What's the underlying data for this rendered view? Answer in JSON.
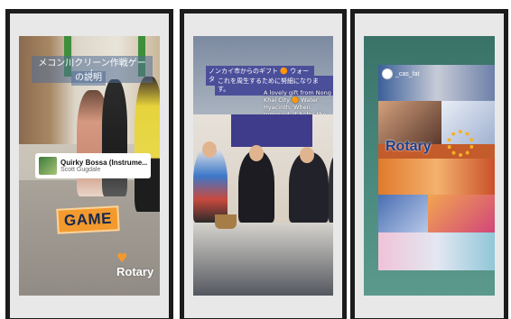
{
  "panels": [
    {
      "title_line1": "メコン川クリーン作戦ゲーム",
      "title_line2": "の説明",
      "music_title": "Quirky Bossa (Instrume...",
      "music_artist": "Scott Gugdale",
      "sticker": "GAME",
      "logo_heart": "♥",
      "logo_text": "Rotary"
    },
    {
      "tag_line1": "ノンカイ市からのギフト 🟠 ウォーターヒア",
      "tag_line2": "これを周生するために努細になります。",
      "caption": "A lovely gift from Nong Khai City 🟠 Water Hyacinth. When removed, it helps the river stay clean and beautiful."
    },
    {
      "handle": "_cas_fat",
      "collage_text": "Rotary"
    }
  ],
  "colors": {
    "frame": "#1c1c1c",
    "rotary_blue": "#1b3f8f",
    "rotary_gold": "#f2b229",
    "game_orange": "#f39a2e"
  }
}
